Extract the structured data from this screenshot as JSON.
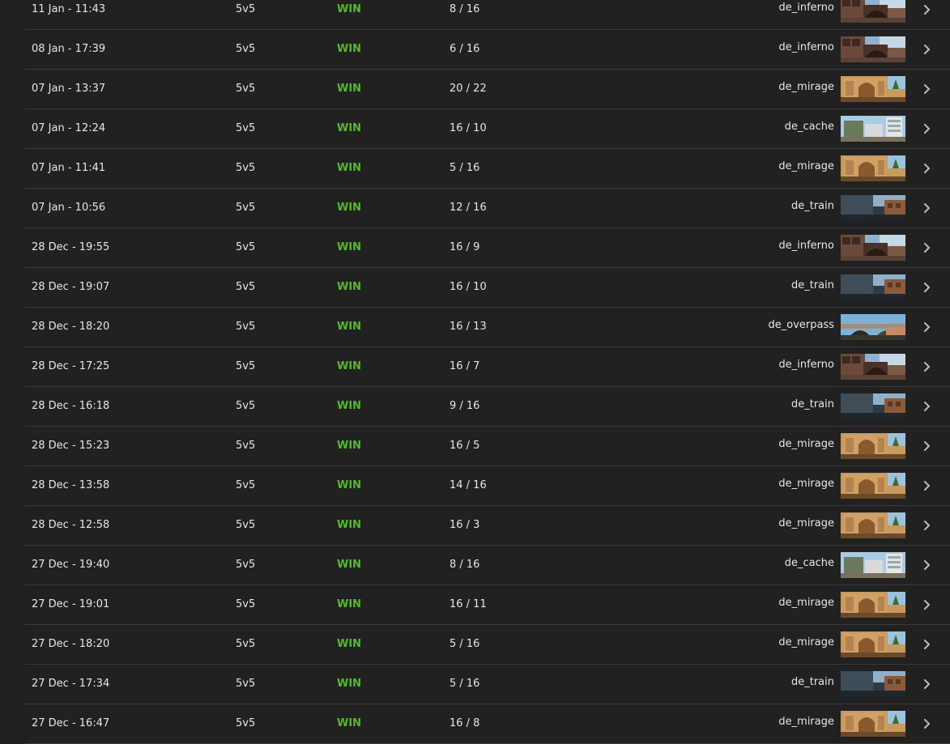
{
  "colors": {
    "background": "#212121",
    "divider": "#3a3a3a",
    "text": "#e6e6e6",
    "win": "#58b82b"
  },
  "icons": {
    "row_arrow": "chevron-right-icon"
  },
  "matches": [
    {
      "date": "11 Jan - 11:43",
      "mode": "5v5",
      "result": "WIN",
      "score": "8 / 16",
      "map": "de_inferno"
    },
    {
      "date": "08 Jan - 17:39",
      "mode": "5v5",
      "result": "WIN",
      "score": "6 / 16",
      "map": "de_inferno"
    },
    {
      "date": "07 Jan - 13:37",
      "mode": "5v5",
      "result": "WIN",
      "score": "20 / 22",
      "map": "de_mirage"
    },
    {
      "date": "07 Jan - 12:24",
      "mode": "5v5",
      "result": "WIN",
      "score": "16 / 10",
      "map": "de_cache"
    },
    {
      "date": "07 Jan - 11:41",
      "mode": "5v5",
      "result": "WIN",
      "score": "5 / 16",
      "map": "de_mirage"
    },
    {
      "date": "07 Jan - 10:56",
      "mode": "5v5",
      "result": "WIN",
      "score": "12 / 16",
      "map": "de_train"
    },
    {
      "date": "28 Dec - 19:55",
      "mode": "5v5",
      "result": "WIN",
      "score": "16 / 9",
      "map": "de_inferno"
    },
    {
      "date": "28 Dec - 19:07",
      "mode": "5v5",
      "result": "WIN",
      "score": "16 / 10",
      "map": "de_train"
    },
    {
      "date": "28 Dec - 18:20",
      "mode": "5v5",
      "result": "WIN",
      "score": "16 / 13",
      "map": "de_overpass"
    },
    {
      "date": "28 Dec - 17:25",
      "mode": "5v5",
      "result": "WIN",
      "score": "16 / 7",
      "map": "de_inferno"
    },
    {
      "date": "28 Dec - 16:18",
      "mode": "5v5",
      "result": "WIN",
      "score": "9 / 16",
      "map": "de_train"
    },
    {
      "date": "28 Dec - 15:23",
      "mode": "5v5",
      "result": "WIN",
      "score": "16 / 5",
      "map": "de_mirage"
    },
    {
      "date": "28 Dec - 13:58",
      "mode": "5v5",
      "result": "WIN",
      "score": "14 / 16",
      "map": "de_mirage"
    },
    {
      "date": "28 Dec - 12:58",
      "mode": "5v5",
      "result": "WIN",
      "score": "16 / 3",
      "map": "de_mirage"
    },
    {
      "date": "27 Dec - 19:40",
      "mode": "5v5",
      "result": "WIN",
      "score": "8 / 16",
      "map": "de_cache"
    },
    {
      "date": "27 Dec - 19:01",
      "mode": "5v5",
      "result": "WIN",
      "score": "16 / 11",
      "map": "de_mirage"
    },
    {
      "date": "27 Dec - 18:20",
      "mode": "5v5",
      "result": "WIN",
      "score": "5 / 16",
      "map": "de_mirage"
    },
    {
      "date": "27 Dec - 17:34",
      "mode": "5v5",
      "result": "WIN",
      "score": "5 / 16",
      "map": "de_train"
    },
    {
      "date": "27 Dec - 16:47",
      "mode": "5v5",
      "result": "WIN",
      "score": "16 / 8",
      "map": "de_mirage"
    }
  ]
}
